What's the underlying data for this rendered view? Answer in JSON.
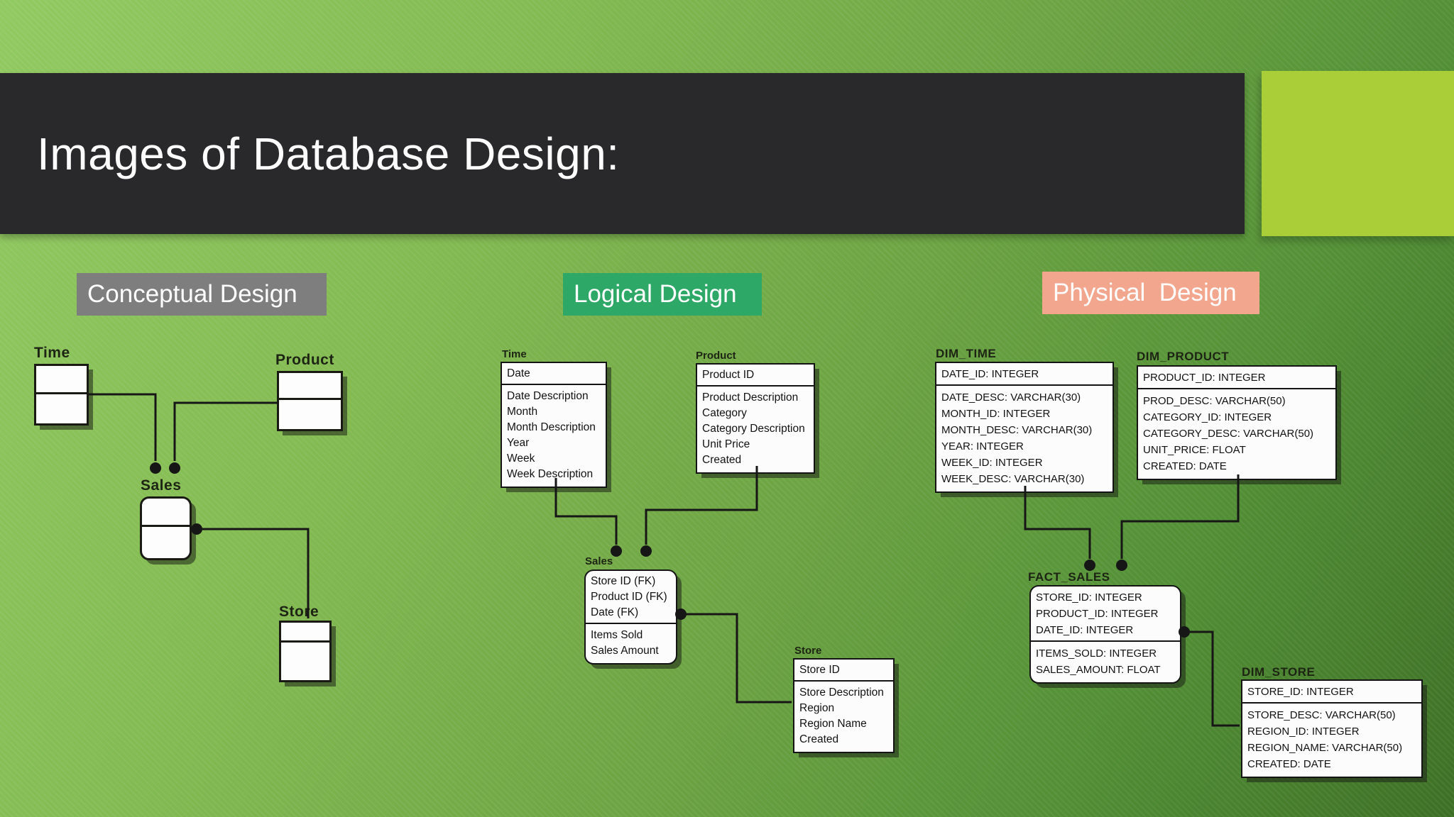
{
  "title": "Images of Database Design:",
  "sections": {
    "conceptual_label": "Conceptual Design",
    "logical_label": "Logical Design",
    "physical_label": "Physical  Design"
  },
  "conceptual": {
    "entities": [
      {
        "name": "Time"
      },
      {
        "name": "Product"
      },
      {
        "name": "Sales"
      },
      {
        "name": "Store"
      }
    ],
    "relationships": [
      "Time-Sales",
      "Product-Sales",
      "Sales-Store"
    ]
  },
  "logical": {
    "tables": [
      {
        "name": "Time",
        "keys": [
          "Date"
        ],
        "attrs": [
          "Date Description",
          "Month",
          "Month Description",
          "Year",
          "Week",
          "Week Description"
        ]
      },
      {
        "name": "Product",
        "keys": [
          "Product ID"
        ],
        "attrs": [
          "Product Description",
          "Category",
          "Category Description",
          "Unit Price",
          "Created"
        ]
      },
      {
        "name": "Sales",
        "keys": [
          "Store ID (FK)",
          "Product ID (FK)",
          "Date (FK)"
        ],
        "attrs": [
          "Items Sold",
          "Sales Amount"
        ]
      },
      {
        "name": "Store",
        "keys": [
          "Store ID"
        ],
        "attrs": [
          "Store Description",
          "Region",
          "Region Name",
          "Created"
        ]
      }
    ],
    "relationships": [
      "Time-Sales",
      "Product-Sales",
      "Sales-Store"
    ]
  },
  "physical": {
    "tables": [
      {
        "name": "DIM_TIME",
        "keys": [
          "DATE_ID: INTEGER"
        ],
        "attrs": [
          "DATE_DESC: VARCHAR(30)",
          "MONTH_ID: INTEGER",
          "MONTH_DESC: VARCHAR(30)",
          "YEAR: INTEGER",
          "WEEK_ID: INTEGER",
          "WEEK_DESC: VARCHAR(30)"
        ]
      },
      {
        "name": "DIM_PRODUCT",
        "keys": [
          "PRODUCT_ID: INTEGER"
        ],
        "attrs": [
          "PROD_DESC: VARCHAR(50)",
          "CATEGORY_ID: INTEGER",
          "CATEGORY_DESC: VARCHAR(50)",
          "UNIT_PRICE: FLOAT",
          "CREATED: DATE"
        ]
      },
      {
        "name": "FACT_SALES",
        "keys": [
          "STORE_ID: INTEGER",
          "PRODUCT_ID: INTEGER",
          "DATE_ID: INTEGER"
        ],
        "attrs": [
          "ITEMS_SOLD: INTEGER",
          "SALES_AMOUNT: FLOAT"
        ]
      },
      {
        "name": "DIM_STORE",
        "keys": [
          "STORE_ID: INTEGER"
        ],
        "attrs": [
          "STORE_DESC: VARCHAR(50)",
          "REGION_ID: INTEGER",
          "REGION_NAME: VARCHAR(50)",
          "CREATED: DATE"
        ]
      }
    ],
    "relationships": [
      "DIM_TIME-FACT_SALES",
      "DIM_PRODUCT-FACT_SALES",
      "FACT_SALES-DIM_STORE"
    ]
  },
  "colors": {
    "background_light": "#92ca62",
    "background_dark": "#3d7025",
    "title_bar": "#29292b",
    "title_text": "#fcfcfc",
    "accent_square": "#a9ce37",
    "conceptual_label_bg": "#7e7e7e",
    "logical_label_bg": "#2ea866",
    "physical_label_bg": "#f2a68e",
    "box_fill": "#fcfcfc",
    "line_color": "#161616"
  }
}
